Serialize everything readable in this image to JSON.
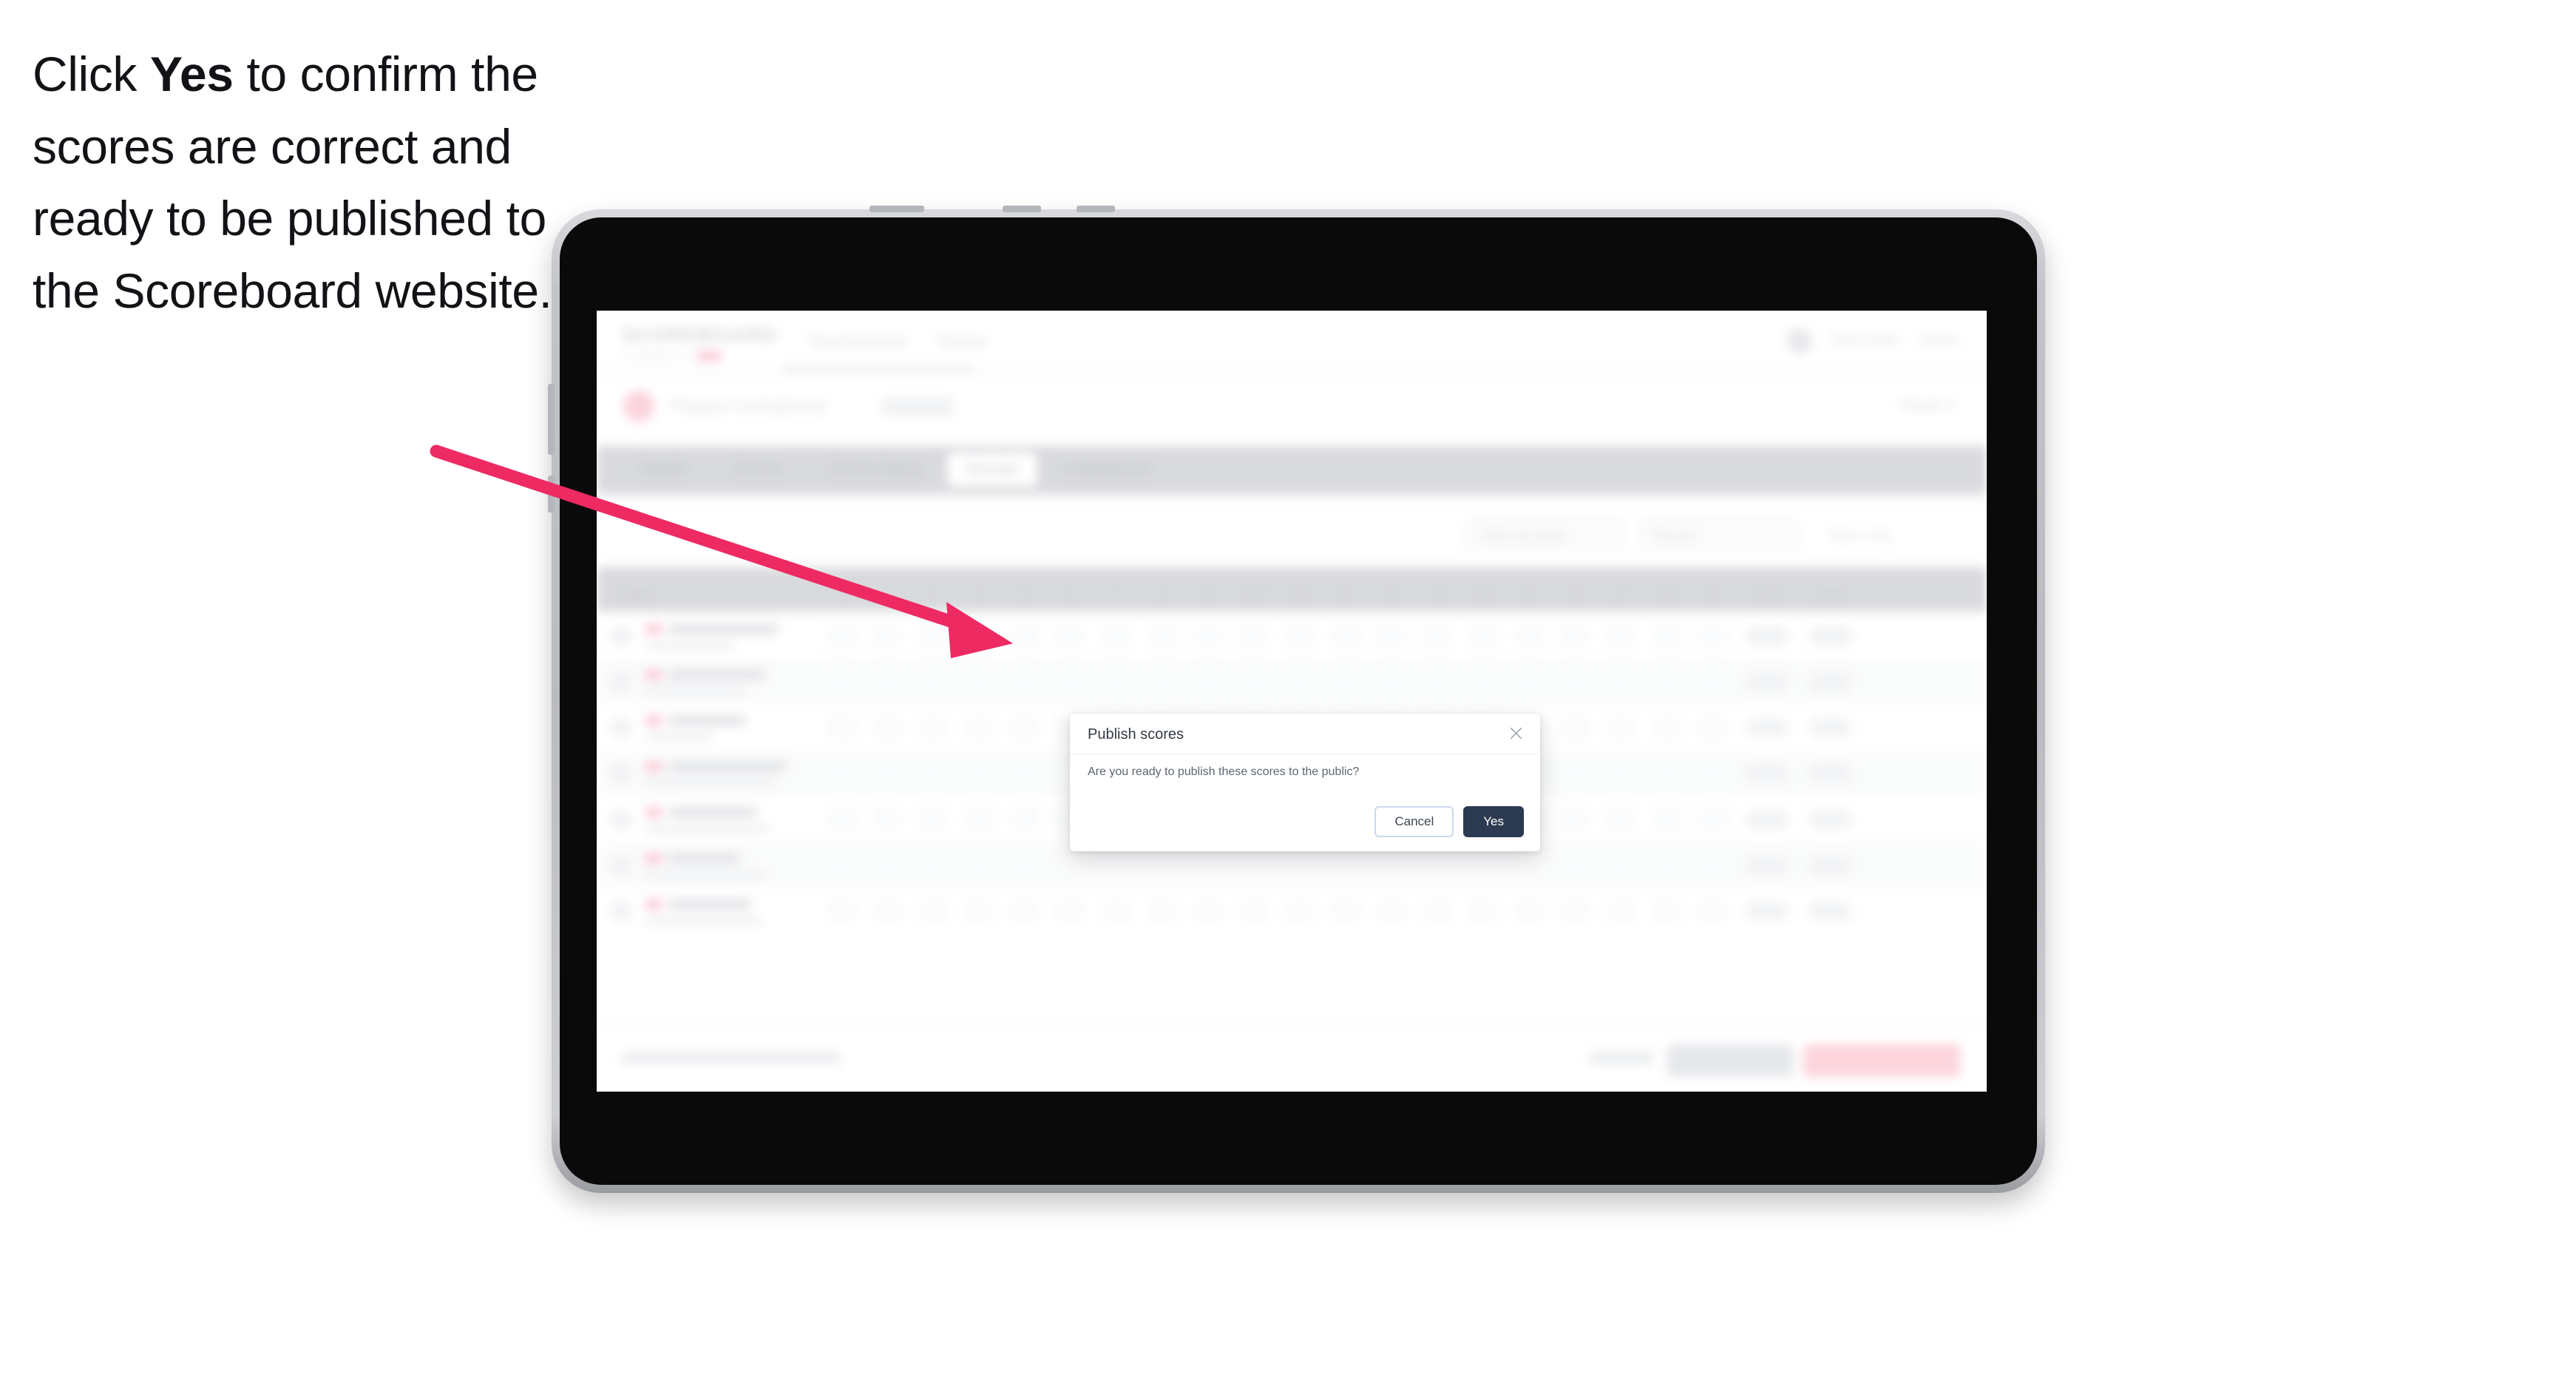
{
  "caption": {
    "before": "Click ",
    "emphasis": "Yes",
    "after": " to confirm the scores are correct and ready to be published to the Scoreboard website."
  },
  "modal": {
    "title": "Publish scores",
    "body": "Are you ready to publish these scores to the public?",
    "close_icon": "close-icon",
    "cancel_label": "Cancel",
    "yes_label": "Yes"
  },
  "app": {
    "logo_word": "SCOREBOARD",
    "logo_sub": "POWERED BY",
    "nav": [
      {
        "label": "Tournaments"
      },
      {
        "label": "Teams"
      }
    ],
    "nav_right": [
      {
        "label": "Matt Coller"
      },
      {
        "label": "Admin"
      }
    ],
    "tournament": {
      "name": "Pagosi Invitational",
      "chip": "Event",
      "right_meta": "Week 4"
    },
    "tabs": [
      {
        "label": "Details",
        "active": false
      },
      {
        "label": "Course",
        "active": false
      },
      {
        "label": "Course Setup",
        "active": false
      },
      {
        "label": "Results",
        "active": true
      },
      {
        "label": "Leaderboard",
        "active": false
      }
    ],
    "filters": [
      {
        "label": "Filter by team"
      },
      {
        "label": "Round"
      },
      {
        "label": "Team only"
      }
    ],
    "table": {
      "headers": [
        "Player",
        "1",
        "2",
        "3",
        "4",
        "5",
        "6",
        "7",
        "8",
        "9",
        "OUT",
        "10",
        "11",
        "12",
        "13",
        "14",
        "15",
        "16",
        "17",
        "18",
        "IN",
        "Total",
        "Score"
      ],
      "rows": [
        {
          "flag": true,
          "name_w": 148,
          "club_w": 120,
          "alt": false
        },
        {
          "flag": true,
          "name_w": 130,
          "club_w": 134,
          "alt": true
        },
        {
          "flag": true,
          "name_w": 104,
          "club_w": 92,
          "alt": false
        },
        {
          "flag": true,
          "name_w": 158,
          "club_w": 176,
          "alt": true
        },
        {
          "flag": true,
          "name_w": 120,
          "club_w": 168,
          "alt": false
        },
        {
          "flag": true,
          "name_w": 96,
          "club_w": 162,
          "alt": true
        },
        {
          "flag": true,
          "name_w": 112,
          "club_w": 158,
          "alt": false
        }
      ]
    },
    "footer": {
      "note": "Scores not entered are not final",
      "link": "Cancel",
      "secondary_button": "Save",
      "primary_button": "Publish scores"
    }
  },
  "colors": {
    "accent_pink": "#ee2a62",
    "yes_button": "#2c3a51",
    "cancel_border": "#ccd8ee",
    "tabbar": "#d9dade",
    "device_bezel": "#c2c4c9",
    "screen_black": "#0a0a0a"
  }
}
